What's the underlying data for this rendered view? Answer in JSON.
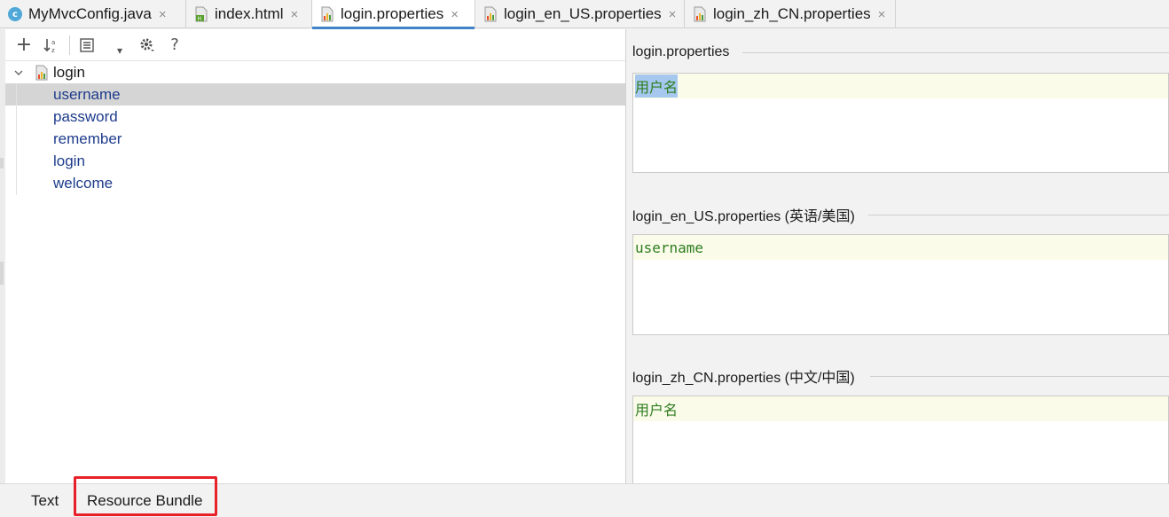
{
  "tabs": [
    {
      "label": "MyMvcConfig.java",
      "icon": "java-class-icon",
      "active": false
    },
    {
      "label": "index.html",
      "icon": "html-file-icon",
      "active": false
    },
    {
      "label": "login.properties",
      "icon": "properties-file-icon",
      "active": true
    },
    {
      "label": "login_en_US.properties",
      "icon": "properties-file-icon",
      "active": false
    },
    {
      "label": "login_zh_CN.properties",
      "icon": "properties-file-icon",
      "active": false
    }
  ],
  "tab_close_glyph": "×",
  "toolbar": {
    "add": "+",
    "sort": "↓",
    "group": "≡",
    "dropdown": "▾",
    "settings": "⚙",
    "help": "?"
  },
  "tree": {
    "root": "login",
    "items": [
      "username",
      "password",
      "remember",
      "login",
      "welcome"
    ],
    "selected_index": 0
  },
  "sections": [
    {
      "title": "login.properties",
      "value": "用户名"
    },
    {
      "title": "login_en_US.properties (英语/美国)",
      "value": "username"
    },
    {
      "title": "login_zh_CN.properties (中文/中国)",
      "value": "用户名"
    }
  ],
  "bottom_tabs": {
    "text": "Text",
    "resource_bundle": "Resource Bundle"
  },
  "colors": {
    "accent": "#4083c9",
    "highlight": "#e8202a",
    "value_text": "#2e7d1f",
    "key_text": "#1e3c8c"
  }
}
